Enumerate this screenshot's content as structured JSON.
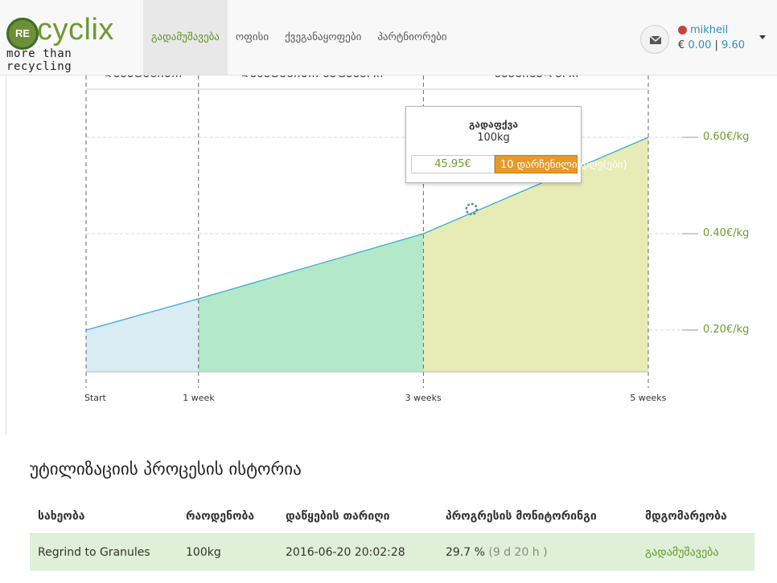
{
  "header": {
    "logo": {
      "badge": "RE",
      "word": "cyclix",
      "tagline": "more than recycling"
    },
    "nav": [
      {
        "label": "გადამუშავება",
        "active": true
      },
      {
        "label": "ოფისი",
        "active": false
      },
      {
        "label": "ქვეგანაყოფები",
        "active": false
      },
      {
        "label": "პარტნიორები",
        "active": false
      }
    ],
    "user": {
      "name": "mikheil",
      "currency": "€",
      "balance": "0.00",
      "separator": "|",
      "limit": "9.60"
    },
    "icons": {
      "mail": "envelope-icon",
      "status": "status-dot-icon",
      "caret": "caret-down-icon"
    }
  },
  "chart_data": {
    "type": "area",
    "x": [
      "Start",
      "1 week",
      "3 weeks",
      "5 weeks"
    ],
    "x_days": [
      0,
      7,
      21,
      35
    ],
    "y_ticks": [
      "0.20€/kg",
      "0.40€/kg",
      "0.60€/kg"
    ],
    "ylim": [
      0.115,
      0.72
    ],
    "points": [
      {
        "day": 0,
        "value": 0.2
      },
      {
        "day": 7,
        "value": 0.265
      },
      {
        "day": 21,
        "value": 0.4
      },
      {
        "day": 35,
        "value": 0.6
      }
    ],
    "band_colors": [
      "#d9ebf3",
      "#b3e9c9",
      "#e7ebb6"
    ],
    "line_color": "#3aacd0",
    "band_labels": [
      "ᲓᲐᲛᲐᲢᲔᲑᲘᲗᲘ",
      "ᲓᲐᲛᲐᲢᲔᲑᲘᲗᲘ ᲡᲐᲤᲐᲡᲣᲠᲘ",
      "ᲛᲐᲥᲡᲘᲛᲐᲚᲣᲠᲘ"
    ],
    "marker": {
      "day": 24,
      "value": 0.451
    },
    "tooltip": {
      "title": "გადაფქვა",
      "weight": "100kg",
      "price": "45.95€",
      "days_left": "10 დარჩენილი დღე(ები)"
    }
  },
  "history": {
    "title": "უტილიზაციის პროცესის ისტორია",
    "columns": [
      "სახეობა",
      "რაოდენობა",
      "დაწყების თარიღი",
      "პროგრესის მონიტორინგი",
      "მდგომარეობა"
    ],
    "rows": [
      {
        "type": "Regrind to Granules",
        "amount": "100kg",
        "date": "2016-06-20 20:02:28",
        "progress": "29.7 %",
        "remaining": "(9 d 20 h )",
        "state": "გადამუშავება"
      }
    ]
  }
}
